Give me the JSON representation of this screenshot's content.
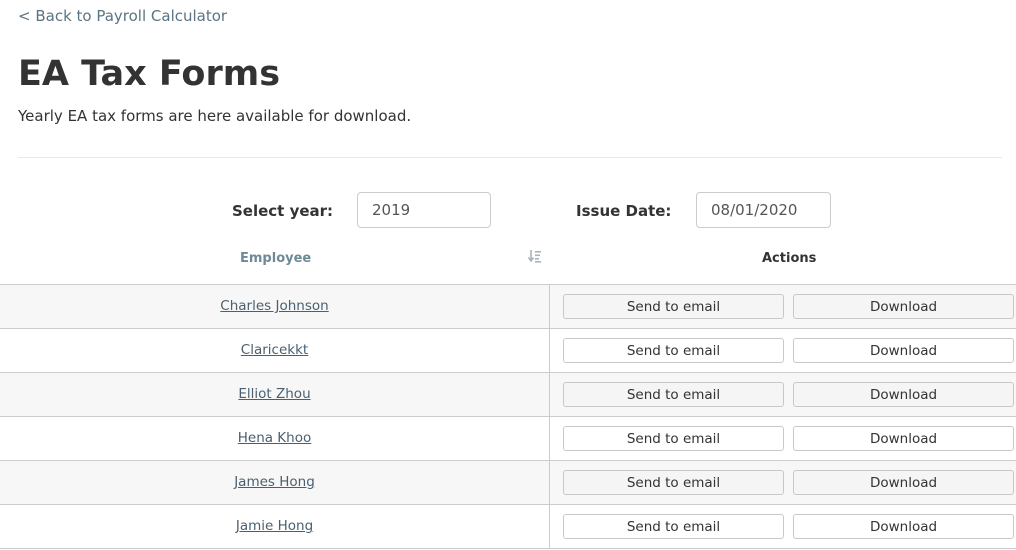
{
  "nav": {
    "back_label": "< Back to Payroll Calculator"
  },
  "header": {
    "title": "EA Tax Forms",
    "subtitle": "Yearly EA tax forms are here available for download."
  },
  "filters": {
    "year_label": "Select year:",
    "year_value": "2019",
    "issue_label": "Issue Date:",
    "issue_value": "08/01/2020"
  },
  "table": {
    "columns": [
      "Employee",
      "Actions"
    ],
    "sort_icon": "sort-descending-icon",
    "send_label": "Send to email",
    "download_label": "Download",
    "rows": [
      "Charles Johnson",
      "Claricekkt",
      "Elliot Zhou",
      "Hena Khoo",
      "James Hong",
      "Jamie Hong"
    ]
  },
  "colors": {
    "header_link": "#6d8a96",
    "link": "#4a6070",
    "stripe": "#f7f7f7"
  }
}
